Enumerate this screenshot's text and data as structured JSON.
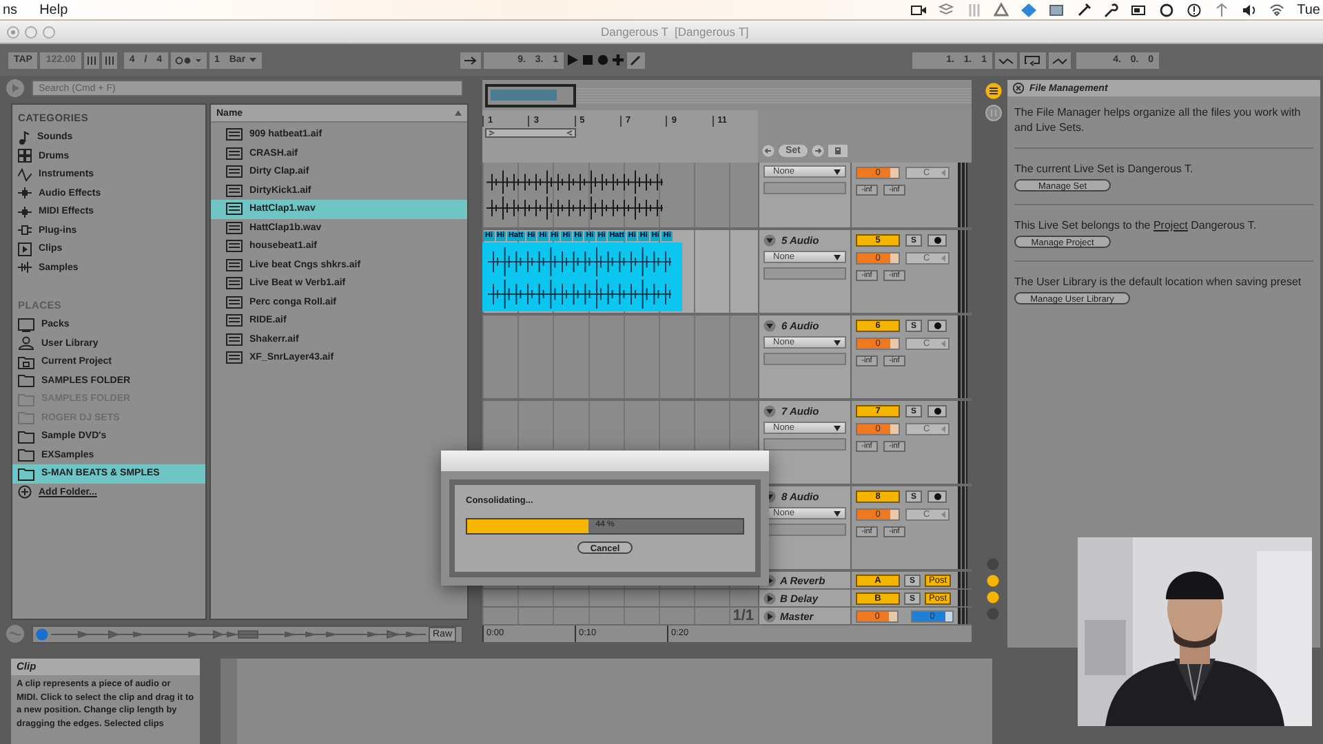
{
  "menu_bar": {
    "items": [
      "ns",
      "Help"
    ],
    "clock": "Tue"
  },
  "window": {
    "title": "Dangerous T  [Dangerous T]"
  },
  "transport": {
    "tap": "TAP",
    "tempo": "122.00",
    "signature": "4 / 4",
    "quantization": "1 Bar",
    "position": "9. 3. 1",
    "loop_start": "1. 1. 1",
    "loop_length": "4. 0. 0"
  },
  "browser": {
    "search": {
      "placeholder": "Search (Cmd + F)"
    },
    "categories_heading": "CATEGORIES",
    "categories": [
      {
        "label": "Sounds",
        "kind": "sounds",
        "selected": false
      },
      {
        "label": "Drums",
        "kind": "drums",
        "selected": false
      },
      {
        "label": "Instruments",
        "kind": "instruments",
        "selected": false
      },
      {
        "label": "Audio Effects",
        "kind": "audio_effects",
        "selected": false
      },
      {
        "label": "MIDI Effects",
        "kind": "midi_effects",
        "selected": false
      },
      {
        "label": "Plug-ins",
        "kind": "plugins",
        "selected": false
      },
      {
        "label": "Clips",
        "kind": "clips",
        "selected": false
      },
      {
        "label": "Samples",
        "kind": "samples",
        "selected": false
      }
    ],
    "places_heading": "PLACES",
    "places": [
      {
        "label": "Packs",
        "kind": "packs",
        "disabled": false,
        "selected": false
      },
      {
        "label": "User Library",
        "kind": "library",
        "disabled": false,
        "selected": false
      },
      {
        "label": "Current Project",
        "kind": "project",
        "disabled": false,
        "selected": false
      },
      {
        "label": "SAMPLES FOLDER",
        "kind": "folder",
        "disabled": false,
        "selected": false
      },
      {
        "label": "SAMPLES FOLDER",
        "kind": "folder",
        "disabled": true,
        "selected": false
      },
      {
        "label": "ROGER DJ SETS",
        "kind": "folder",
        "disabled": true,
        "selected": false
      },
      {
        "label": "Sample DVD's",
        "kind": "folder",
        "disabled": false,
        "selected": false
      },
      {
        "label": "EXSamples",
        "kind": "folder",
        "disabled": false,
        "selected": false
      },
      {
        "label": "S-MAN BEATS & SMPLES",
        "kind": "folder",
        "disabled": false,
        "selected": true
      },
      {
        "label": "Add Folder...",
        "kind": "add",
        "disabled": false,
        "selected": false
      }
    ],
    "column_header": "Name",
    "files": [
      {
        "name": "909 hatbeat1.aif",
        "selected": false
      },
      {
        "name": "CRASH.aif",
        "selected": false
      },
      {
        "name": "Dirty Clap.aif",
        "selected": false
      },
      {
        "name": "DirtyKick1.aif",
        "selected": false
      },
      {
        "name": "HattClap1.wav",
        "selected": true
      },
      {
        "name": "HattClap1b.wav",
        "selected": false
      },
      {
        "name": "housebeat1.aif",
        "selected": false
      },
      {
        "name": "Live beat Cngs shkrs.aif",
        "selected": false
      },
      {
        "name": "Live Beat w Verb1.aif",
        "selected": false
      },
      {
        "name": "Perc conga Roll.aif",
        "selected": false
      },
      {
        "name": "RIDE.aif",
        "selected": false
      },
      {
        "name": "Shakerr.aif",
        "selected": false
      },
      {
        "name": "XF_SnrLayer43.aif",
        "selected": false
      }
    ],
    "preview": {
      "raw": "Raw"
    }
  },
  "arrangement": {
    "bar_numbers": [
      "1",
      "3",
      "5",
      "7",
      "9",
      "11"
    ],
    "set_button": "Set",
    "tracks": [
      {
        "kind": "audio",
        "input": "None",
        "volume": "0",
        "pan": "C",
        "meters": [
          "-inf",
          "-inf"
        ],
        "clip": {
          "selected": false
        }
      },
      {
        "kind": "audio",
        "name": "5 Audio",
        "number": "5",
        "solo": "S",
        "input": "None",
        "volume": "0",
        "pan": "C",
        "meters": [
          "-inf",
          "-inf"
        ],
        "clip": {
          "selected": true,
          "labels": [
            "Hi",
            "Hi",
            "Hatt",
            "Hi",
            "Hi",
            "Hi",
            "Hi",
            "Hi",
            "Hi",
            "Hi",
            "Hatt",
            "Hi",
            "Hi",
            "Hi",
            "Hi"
          ]
        }
      },
      {
        "kind": "audio",
        "name": "6 Audio",
        "number": "6",
        "solo": "S",
        "input": "None",
        "volume": "0",
        "pan": "C",
        "meters": [
          "-inf",
          "-inf"
        ]
      },
      {
        "kind": "audio",
        "name": "7 Audio",
        "number": "7",
        "solo": "S",
        "input": "None",
        "volume": "0",
        "pan": "C",
        "meters": [
          "-inf",
          "-inf"
        ]
      },
      {
        "kind": "audio",
        "name": "8 Audio",
        "number": "8",
        "solo": "S",
        "input": "None",
        "volume": "0",
        "pan": "C",
        "meters": [
          "-inf",
          "-inf"
        ]
      },
      {
        "kind": "return",
        "name": "A Reverb",
        "number": "A",
        "solo": "S",
        "post": "Post"
      },
      {
        "kind": "return",
        "name": "B Delay",
        "number": "B",
        "solo": "S",
        "post": "Post"
      },
      {
        "kind": "master",
        "name": "Master",
        "lane_text": "1/1",
        "volume": "0",
        "cue": "0"
      }
    ],
    "times": [
      "0:00",
      "0:10",
      "0:20"
    ]
  },
  "help": {
    "title": "File Management",
    "intro": "The File Manager helps organize all the files you work with and Live Sets.",
    "sections": [
      {
        "text": "The current Live Set is Dangerous T.",
        "button": "Manage Set"
      },
      {
        "text_before": "This Live Set belongs to the",
        "link": "Project",
        "text_after": "Dangerous T.",
        "button": "Manage Project"
      },
      {
        "text": "The User Library is the default location when saving preset",
        "button": "Manage User Library"
      }
    ]
  },
  "info": {
    "title": "Clip",
    "text": "A clip represents a piece of audio or MIDI. Click to select the clip and drag it to a new position.  Change clip length by dragging the edges. Selected clips"
  },
  "dialog": {
    "message": "Consolidating...",
    "level": 0.44,
    "reading": "44 %",
    "button": "Cancel"
  }
}
